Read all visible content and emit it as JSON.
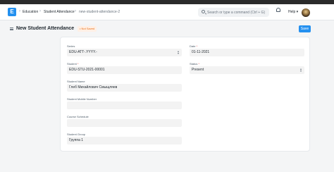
{
  "navbar": {
    "logo_letter": "E",
    "breadcrumbs": [
      "Education",
      "Student Attendance",
      "new-student-attendance-2"
    ],
    "search_placeholder": "Search or type a command (Ctrl + G)",
    "help_label": "Help"
  },
  "page": {
    "title": "New Student Attendance",
    "status_badge": "Not Saved",
    "save_label": "Save"
  },
  "form": {
    "series": {
      "label": "Series",
      "value": "EDU-ATT-.YYYY.-"
    },
    "date": {
      "label": "Date",
      "value": "01-11-2021"
    },
    "student": {
      "label": "Student",
      "value": "EDU-STU-2021-00001"
    },
    "status": {
      "label": "Status",
      "value": "Present"
    },
    "student_name": {
      "label": "Student Name",
      "value": "Глеб Михайлович Смыщляев"
    },
    "student_mobile": {
      "label": "Student Mobile Number",
      "value": ""
    },
    "course_schedule": {
      "label": "Course Schedule",
      "value": ""
    },
    "student_group": {
      "label": "Student Group",
      "value": "Группа 1"
    }
  },
  "colors": {
    "primary": "#2490ef",
    "badge_text": "#e86c13",
    "badge_bg": "#fff0e5"
  }
}
